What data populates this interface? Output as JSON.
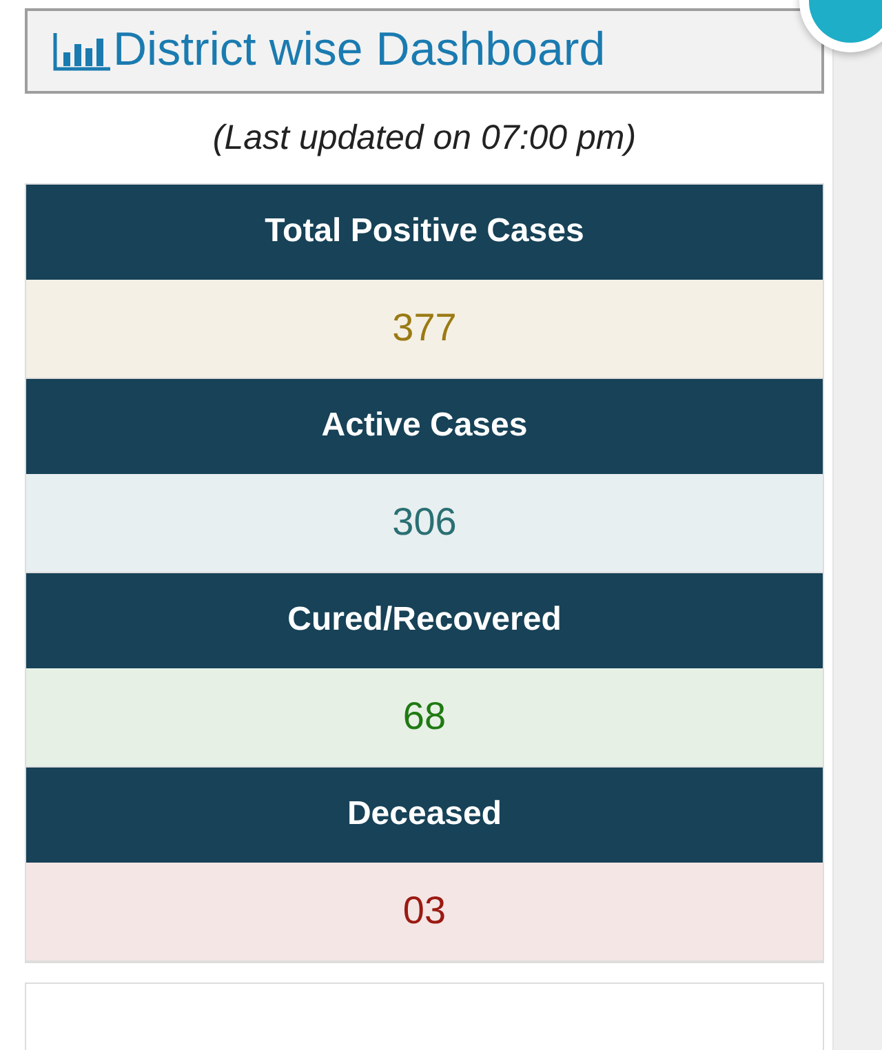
{
  "title": "District wise Dashboard",
  "updated": "(Last updated on 07:00 pm)",
  "stats": [
    {
      "label": "Total Positive Cases",
      "value": "377",
      "color": "#9a7a14"
    },
    {
      "label": "Active Cases",
      "value": "306",
      "color": "#2a6f73"
    },
    {
      "label": "Cured/Recovered",
      "value": "68",
      "color": "#1f7a12"
    },
    {
      "label": "Deceased",
      "value": "03",
      "color": "#9b1a12"
    }
  ]
}
